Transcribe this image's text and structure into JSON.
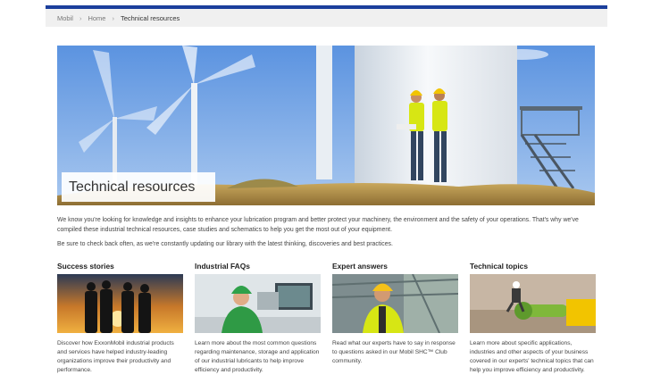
{
  "breadcrumb": {
    "items": [
      "Mobil",
      "Home"
    ],
    "current": "Technical resources"
  },
  "hero": {
    "title": "Technical resources"
  },
  "intro": {
    "p1": "We know you're looking for knowledge and insights to enhance your lubrication program and better protect your machinery, the environment and the safety of your operations. That's why we've compiled these industrial technical resources, case studies and schematics to help you get the most out of your equipment.",
    "p2": "Be sure to check back often, as we're constantly updating our library with the latest thinking, discoveries and best practices."
  },
  "cards": [
    {
      "title": "Success stories",
      "text": "Discover how ExxonMobil industrial products and services have helped industry-leading organizations improve their productivity and performance."
    },
    {
      "title": "Industrial FAQs",
      "text": "Learn more about the most common questions regarding maintenance, storage and application of our industrial lubricants to help improve efficiency and productivity."
    },
    {
      "title": "Expert answers",
      "text": "Read what our experts have to say in response to questions asked in our Mobil SHC™ Club community."
    },
    {
      "title": "Technical topics",
      "text": "Learn more about specific applications, industries and other aspects of your business covered in our experts' technical topics that can help you improve efficiency and productivity."
    }
  ],
  "colors": {
    "brand": "#1b3f9c",
    "breadcrumb_bg": "#f0f0f0",
    "sky": "#6d9fe0"
  }
}
